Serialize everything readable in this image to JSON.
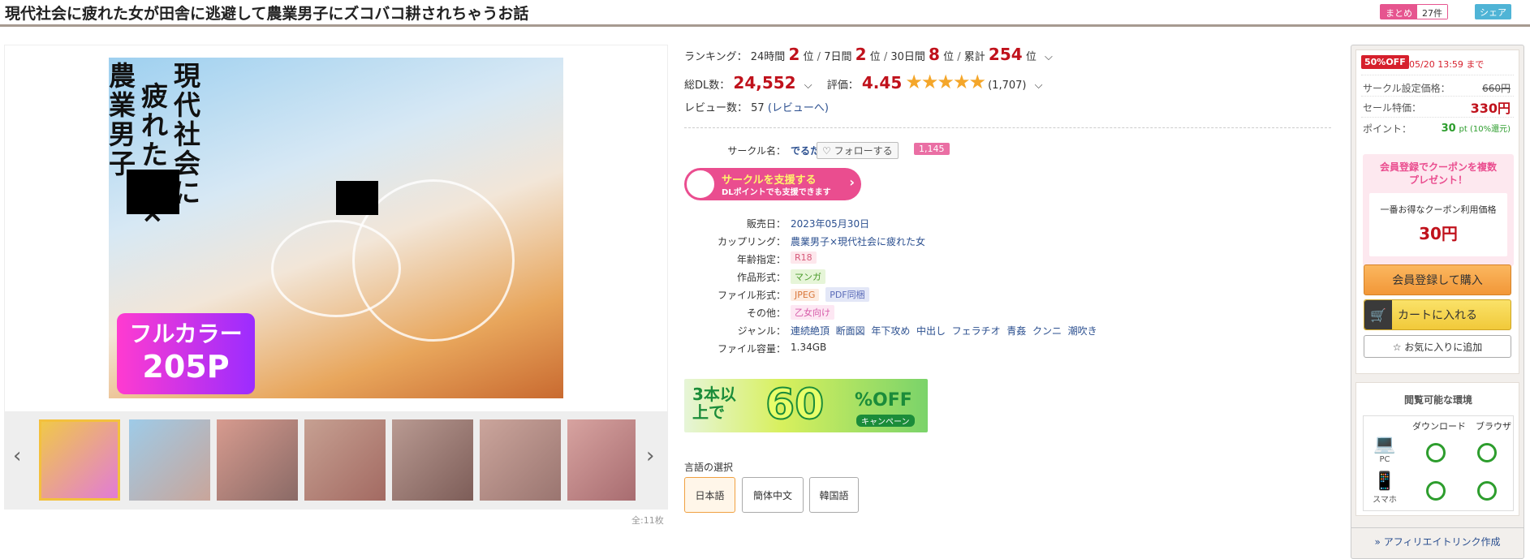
{
  "title": "現代社会に疲れた女が田舎に逃避して農業男子にズコバコ耕されちゃうお話",
  "header": {
    "matome_label": "まとめ",
    "matome_count": "27件",
    "share_label": "シェア"
  },
  "gallery": {
    "cover_vertical_1": "現代社会に",
    "cover_vertical_2": "疲れた女×",
    "cover_vertical_3": "農業男子",
    "cover_badge_1": "フルカラー",
    "cover_badge_2": "205P",
    "count": "全:11枚",
    "prev_icon": "chevron-left-icon",
    "next_icon": "chevron-right-icon"
  },
  "ranking": {
    "label": "ランキング：",
    "p24_label": "24時間",
    "p24": "2",
    "p7_label": "7日間",
    "p7": "2",
    "p30_label": "30日間",
    "p30": "8",
    "total_label": "累計",
    "total": "254",
    "unit": "位"
  },
  "stats": {
    "dl_label": "総DL数：",
    "dl_value": "24,552",
    "rating_label": "評価：",
    "rating_value": "4.45",
    "rating_stars": "★★★★★",
    "rating_count": "(1,707)",
    "review_label": "レビュー数： 57",
    "review_link": "(レビューへ)"
  },
  "circle": {
    "label": "サークル名：",
    "name": "でるたぼ",
    "follow_label": "♡ フォローする",
    "follow_count": "1,145",
    "support_line1": "サークルを支援する",
    "support_line2": "DLポイントでも支援できます"
  },
  "details": {
    "release_label": "販売日：",
    "release": "2023年05月30日",
    "coupling_label": "カップリング：",
    "coupling": "農業男子×現代社会に疲れた女",
    "age_label": "年齢指定：",
    "age": "R18",
    "form_label": "作品形式：",
    "form": "マンガ",
    "file_label": "ファイル形式：",
    "file_1": "JPEG",
    "file_2": "PDF同梱",
    "other_label": "その他：",
    "other": "乙女向け",
    "genre_label": "ジャンル：",
    "genres": [
      "連続絶頂",
      "断面図",
      "年下攻め",
      "中出し",
      "フェラチオ",
      "青姦",
      "クンニ",
      "潮吹き"
    ],
    "size_label": "ファイル容量：",
    "size": "1.34GB"
  },
  "campaign": {
    "left": "3本以上で",
    "num": "60",
    "off": "%OFF",
    "sub": "キャンペーン"
  },
  "language": {
    "label": "言語の選択",
    "options": [
      "日本語",
      "簡体中文",
      "韓国語"
    ],
    "selected": "日本語"
  },
  "side": {
    "off_badge": "50%OFF",
    "off_until": "05/20 13:59 まで",
    "list_label": "サークル設定価格：",
    "list_price": "660円",
    "sale_label": "セール特価：",
    "sale_price": "330円",
    "point_label": "ポイント：",
    "point_value": "30",
    "point_suffix": "pt (10%還元)",
    "promo_title": "会員登録でクーポンを複数\nプレゼント！",
    "promo_card_label": "一番お得なクーポン利用価格",
    "promo_card_value": "30円",
    "buy_label": "会員登録して購入",
    "cart_label": "カートに入れる",
    "fav_label": "☆ お気に入りに追加",
    "env_title": "閲覧可能な環境",
    "env_col_dl": "ダウンロード",
    "env_col_br": "ブラウザ",
    "env_pc": "PC",
    "env_sp": "スマホ",
    "affiliate": "» アフィリエイトリンク作成"
  },
  "colors": {
    "accent_red": "#c0121c",
    "link": "#2b4f8f",
    "pink": "#ea4d8f",
    "star": "#f4a62a"
  }
}
